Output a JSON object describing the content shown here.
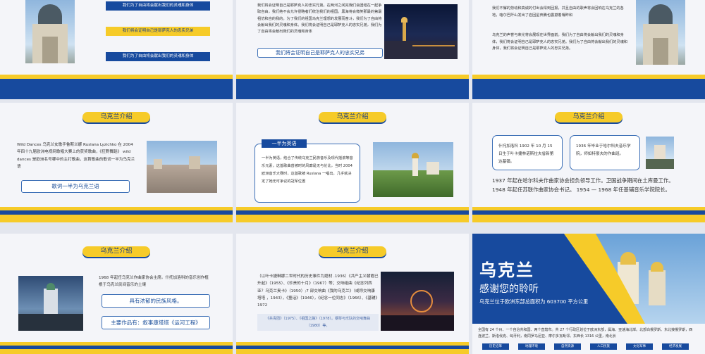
{
  "s1": {
    "banner1": "我们为了自由将会献出我们的灵魂和身体",
    "banner2": "我们将会证明自己是耶萨克人的忠实兄弟",
    "banner3": "我们为了自由将会献出我们的灵魂和身体"
  },
  "s2": {
    "para": "我们将会证明自己是耶萨克人的忠实兄弟。在两河之间完我们会团结在一起争取自由，我们绝不会允许侵略者们统治我们的祖国。黑海将会微笑那最的第最祖仿和自的我的。为了我们的祖国乌克兰理想的发展而奋斗，我们为了自由将会献出我们的灵魂和身体。我们将会证明自己是耶萨克人的忠实兄弟，我们为了自由将会献出我们的灵魂和身体",
    "button": "我们将会证明自己是耶萨克人的忠实兄弟"
  },
  "s3": {
    "para1": "我们不懈的劳动和真诚的付出会得到回报，并且自由的歌声将会回响在乌克兰的各地，喀尔巴阡山发出了岩回星奔腾也震撼着嘎昨和",
    "para2": "乌克兰的声誉与荣光将会展现在世界面前。我们为了自由将会献出我们的灵魂和身体，我们将会证明自己是耶萨克人的忠实兄弟。我们为了自由将会献出我们的灵魂和身体，我们将会证明自己是耶萨克人的忠实兄弟。"
  },
  "s4": {
    "title": "乌克兰介绍",
    "para": "Wild Dances 乌克兰女歌手鲁斯兰娜 Ruslana Lyzichko 在 2004 年四十九届欧洲电视网歌唱大赛上的获奖歌曲，《狂野舞蹈》 wild dances 是欧洲名号哪中的主打歌曲，这首歌曲的歌词一半为乌克兰语",
    "button": "歌词一半为乌克兰语"
  },
  "s5": {
    "title": "乌克兰介绍",
    "tag": "一半为英语",
    "para": "一半为英语，结合了传统乌克兰民族音乐及现代摇滚等音乐元素，这首歌曲曾被时的风靡是无与伦比，当时 2004 欧洲音乐大赛时，这首歌被 Ruslana 一唱出，几乎就决定了她无可争议的冠军位置"
  },
  "s6": {
    "title": "乌克兰介绍",
    "card1": "什托加洛科 1902 年 10 月 15 日生于叶卡捷林诺斯拉夫省新第达基镇。",
    "card2": "1936 年毕业于哈尔科夫音乐学院，师如特豪夫的作曲班。",
    "para": "1937 年起在哈尔科夫作曲家协会担负领导工作。卫国战争期间在土库曼工作。 1948 年起任苏联作曲家协会书记。 1954 — 1968 年任基辅音乐学院院长。"
  },
  "s7": {
    "title": "乌克兰介绍",
    "para": "1968 年起任乌克兰作曲家协会主席。什托加洛科的音乐创作植根于乌克兰民间音乐的土壤",
    "box1": "具有浓郁的民族风格。",
    "box2": "主要作品有：叙事康塔塔《运河工程》"
  },
  "s8": {
    "title": "乌克兰介绍",
    "para": "（以叶卡捷琳娜二世时代的历史事件为题材 .1936）《共产主义朝霞已升起》（1955）、《珍贵的十月》（1967）等；交响组曲《纪念列西亚？乌克兰奥卡》（1950）;7 部交响曲《我的乌克兰》（或称交响康塔塔 ，1943），《童话》（1946），《纪念一位同志》（1966）、《基辅》1972",
    "note": "《共青团》（1975）、《祖国之路》（1978）。钢琴与乐队的交响舞曲（1980）等。"
  },
  "s9": {
    "title": "乌克兰",
    "subtitle": "感谢您的聆听",
    "area": "乌克兰位于欧洲东部总面积为 603700 平方公里",
    "para": "全国有 24 个州、一个自治共和国、两个直辖市。共 27 个行政区划位于欧洲东部，属海、亚速海北岸。北部白俄罗斯、东北接俄罗斯，西连波兰、斯洛伐克、匈牙利，南同罗马尼亚、摩尔多瓦毗邻。东西长 1316 公里，南北长",
    "buttons": [
      "历史沿革",
      "地理环境",
      "自然资源",
      "人口民族",
      "文化军事",
      "经济发展"
    ]
  }
}
